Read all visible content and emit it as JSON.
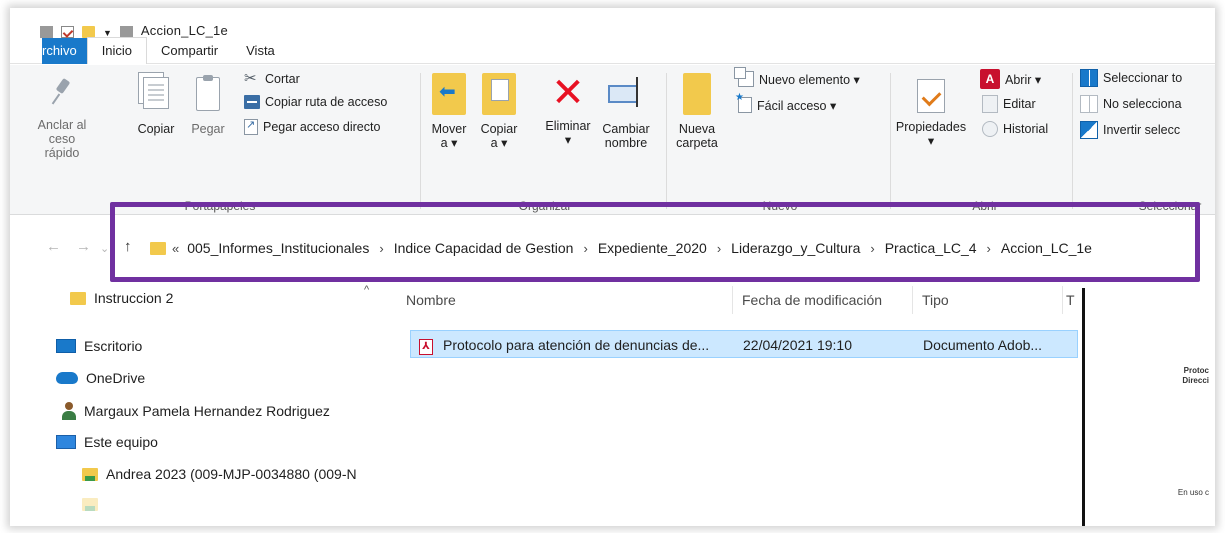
{
  "window": {
    "title": "Accion_LC_1e"
  },
  "ribbon_tabs": [
    "rchivo",
    "Inicio",
    "Compartir",
    "Vista"
  ],
  "clipboard": {
    "pin_label_1": "Anclar al",
    "pin_label_2": "ceso rápido",
    "copy": "Copiar",
    "paste": "Pegar",
    "cut": "Cortar",
    "copy_path": "Copiar ruta de acceso",
    "paste_shortcut": "Pegar acceso directo",
    "group": "Portapapeles"
  },
  "organize": {
    "move_1": "Mover",
    "move_2": "a ▾",
    "copy_1": "Copiar",
    "copy_2": "a ▾",
    "delete_1": "Eliminar",
    "delete_2": "▾",
    "rename_1": "Cambiar",
    "rename_2": "nombre",
    "group": "Organizar"
  },
  "new": {
    "folder_1": "Nueva",
    "folder_2": "carpeta",
    "new_item": "Nuevo elemento ▾",
    "easy_access": "Fácil acceso ▾",
    "group": "Nuevo"
  },
  "open": {
    "properties_1": "Propiedades",
    "properties_2": "▾",
    "open": "Abrir ▾",
    "edit": "Editar",
    "history": "Historial",
    "group": "Abrir"
  },
  "select": {
    "select_all": "Seleccionar to",
    "select_none": "No selecciona",
    "invert": "Invertir selecc",
    "group": "Seleccionar"
  },
  "nav": {
    "back": "←",
    "forward": "→",
    "up": "↑",
    "more": "«"
  },
  "breadcrumbs": [
    "005_Informes_Institucionales",
    "Indice Capacidad de Gestion",
    "Expediente_2020",
    "Liderazgo_y_Cultura",
    "Practica_LC_4",
    "Accion_LC_1e"
  ],
  "nav_pane": {
    "items": [
      "Instruccion 2",
      "Escritorio",
      "OneDrive",
      "Margaux Pamela Hernandez Rodriguez",
      "Este equipo",
      "Andrea 2023 (009-MJP-0034880 (009-N"
    ]
  },
  "file_list": {
    "columns": [
      "Nombre",
      "Fecha de modificación",
      "Tipo",
      "T"
    ],
    "rows": [
      {
        "name": "Protocolo para atención de denuncias de...",
        "modified": "22/04/2021 19:10",
        "type": "Documento Adob..."
      }
    ]
  },
  "preview": {
    "line_1": "Protoc",
    "line_2": "Direcci",
    "line_3": "En uso c"
  },
  "colors": {
    "accent": "#1979ca",
    "highlight_border": "#7030a0",
    "selection": "#cce8ff"
  }
}
